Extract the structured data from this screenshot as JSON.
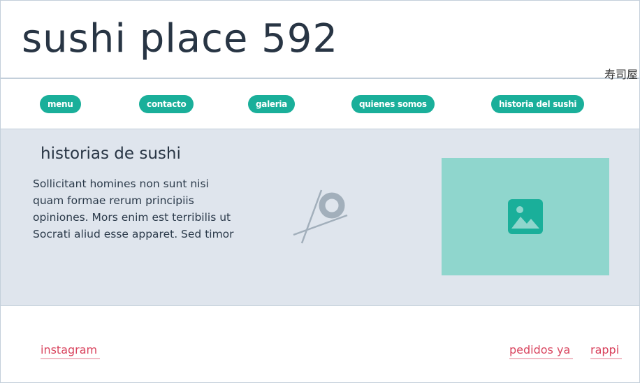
{
  "header": {
    "title": "sushi place 592",
    "subtitle": "寿司屋"
  },
  "nav": {
    "items": [
      {
        "label": "menu"
      },
      {
        "label": "contacto"
      },
      {
        "label": "galeria"
      },
      {
        "label": "quienes somos"
      },
      {
        "label": "historia del sushi"
      }
    ]
  },
  "main": {
    "heading": "historias de sushi",
    "text": "Sollicitant homines non sunt nisi quam formae rerum principiis opiniones. Mors enim est terribilis ut Socrati aliud esse apparet. Sed timor"
  },
  "footer": {
    "links": [
      {
        "label": "instagram"
      },
      {
        "label": "pedidos ya"
      },
      {
        "label": "rappi"
      }
    ]
  },
  "colors": {
    "accent": "#1aaf9a",
    "link": "#d9455f",
    "section_bg": "#dfe5ed"
  }
}
